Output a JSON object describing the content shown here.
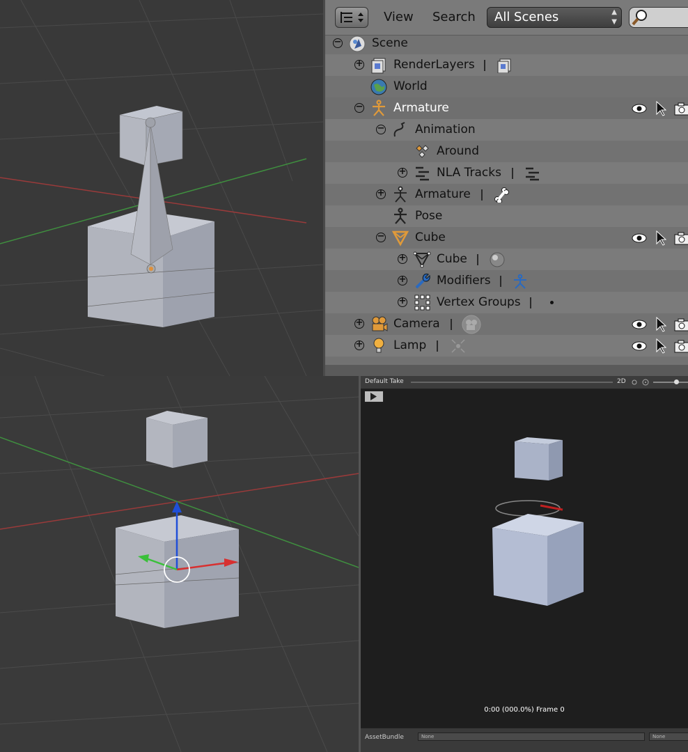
{
  "outliner": {
    "header": {
      "view_menu": "View",
      "search_menu": "Search",
      "scene_filter": "All Scenes"
    },
    "rows": [
      {
        "label": "Scene",
        "icon": "scene-icon",
        "expander": "collapse"
      },
      {
        "label": "RenderLayers",
        "icon": "render-layers-icon",
        "expander": "expand"
      },
      {
        "label": "World",
        "icon": "world-icon"
      },
      {
        "label": "Armature",
        "icon": "armature-object-icon",
        "expander": "collapse",
        "selected": true
      },
      {
        "label": "Animation",
        "icon": "animation-icon",
        "expander": "collapse"
      },
      {
        "label": "Around",
        "icon": "action-icon"
      },
      {
        "label": "NLA Tracks",
        "icon": "nla-tracks-icon",
        "expander": "expand"
      },
      {
        "label": "Armature",
        "icon": "armature-data-icon",
        "expander": "expand"
      },
      {
        "label": "Pose",
        "icon": "pose-icon"
      },
      {
        "label": "Cube",
        "icon": "mesh-object-icon",
        "expander": "collapse"
      },
      {
        "label": "Cube",
        "icon": "mesh-data-icon",
        "expander": "expand"
      },
      {
        "label": "Modifiers",
        "icon": "wrench-icon",
        "expander": "expand"
      },
      {
        "label": "Vertex Groups",
        "icon": "vertex-groups-icon",
        "expander": "expand"
      },
      {
        "label": "Camera",
        "icon": "camera-object-icon",
        "expander": "expand"
      },
      {
        "label": "Lamp",
        "icon": "lamp-object-icon",
        "expander": "expand"
      }
    ]
  },
  "unity": {
    "take": "Default Take",
    "mode": "2D",
    "frame_status": "0:00 (000.0%) Frame 0",
    "asset_bundle_label": "AssetBundle",
    "asset_bundle_value": "None",
    "asset_bundle_variant": "None"
  },
  "colors": {
    "outliner_bg": "#727272",
    "selected_text": "#ffffff",
    "axis_x": "#b33a3a",
    "axis_y": "#3a9a3a",
    "gizmo_z": "#1f4fd8",
    "icon_orange": "#e09a3a"
  }
}
